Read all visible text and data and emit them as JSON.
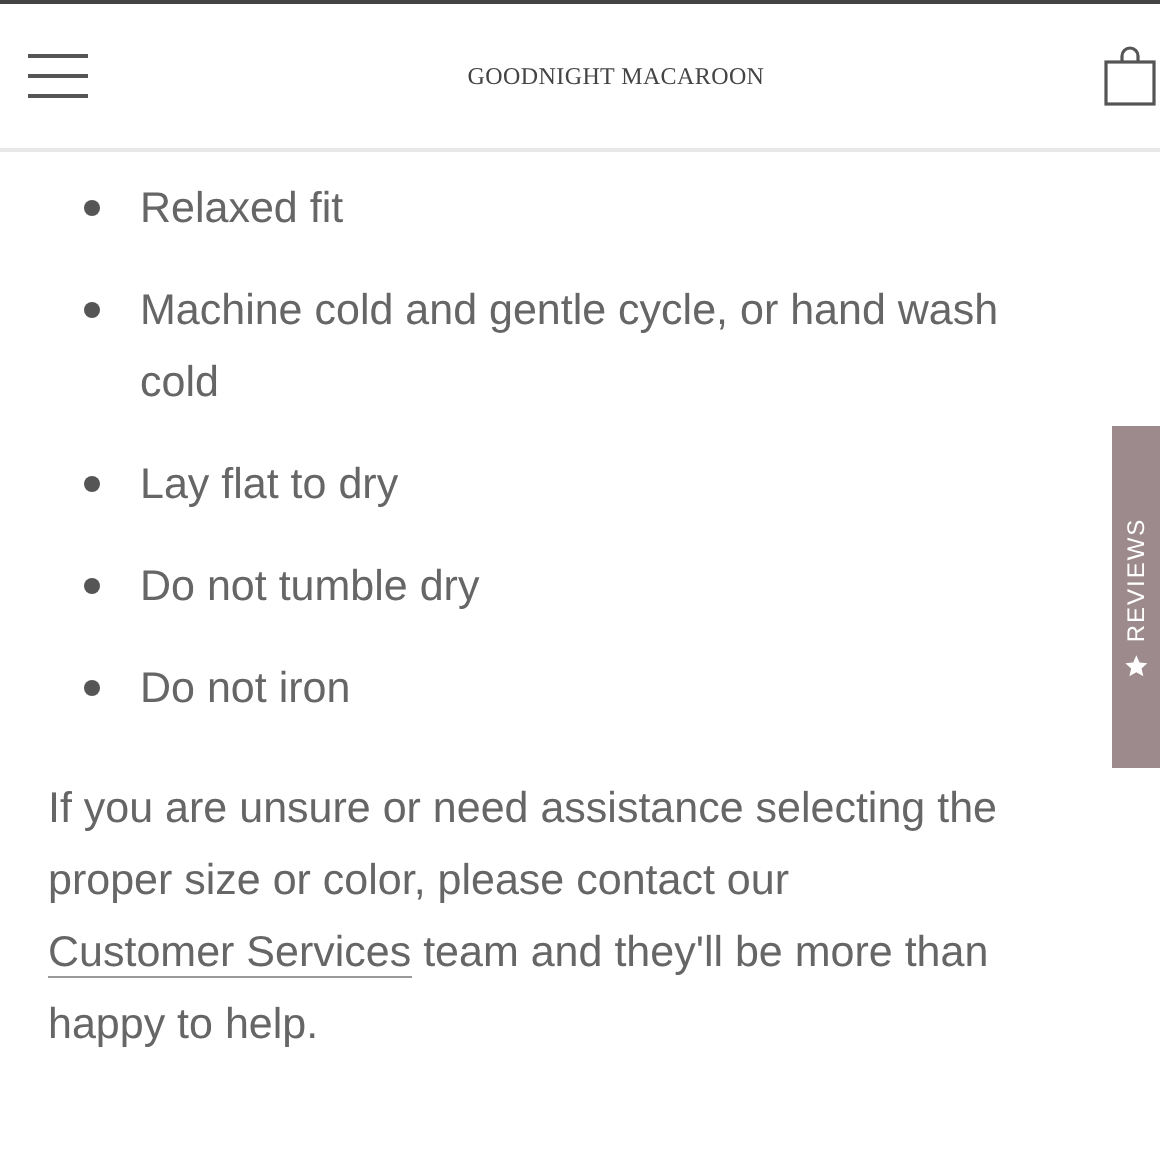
{
  "header": {
    "logo": "GOODNIGHT MACAROON"
  },
  "care_list": [
    "Relaxed fit",
    "Machine cold and gentle cycle, or hand wash cold",
    "Lay flat to dry",
    "Do not tumble dry",
    "Do not iron"
  ],
  "note": {
    "before": "If you are unsure or need assistance selecting the proper size or color, please contact our",
    "link": "Customer Services",
    "after": "team and they'll be more than happy to help."
  },
  "reviews_tab": {
    "label": "REVIEWS"
  }
}
